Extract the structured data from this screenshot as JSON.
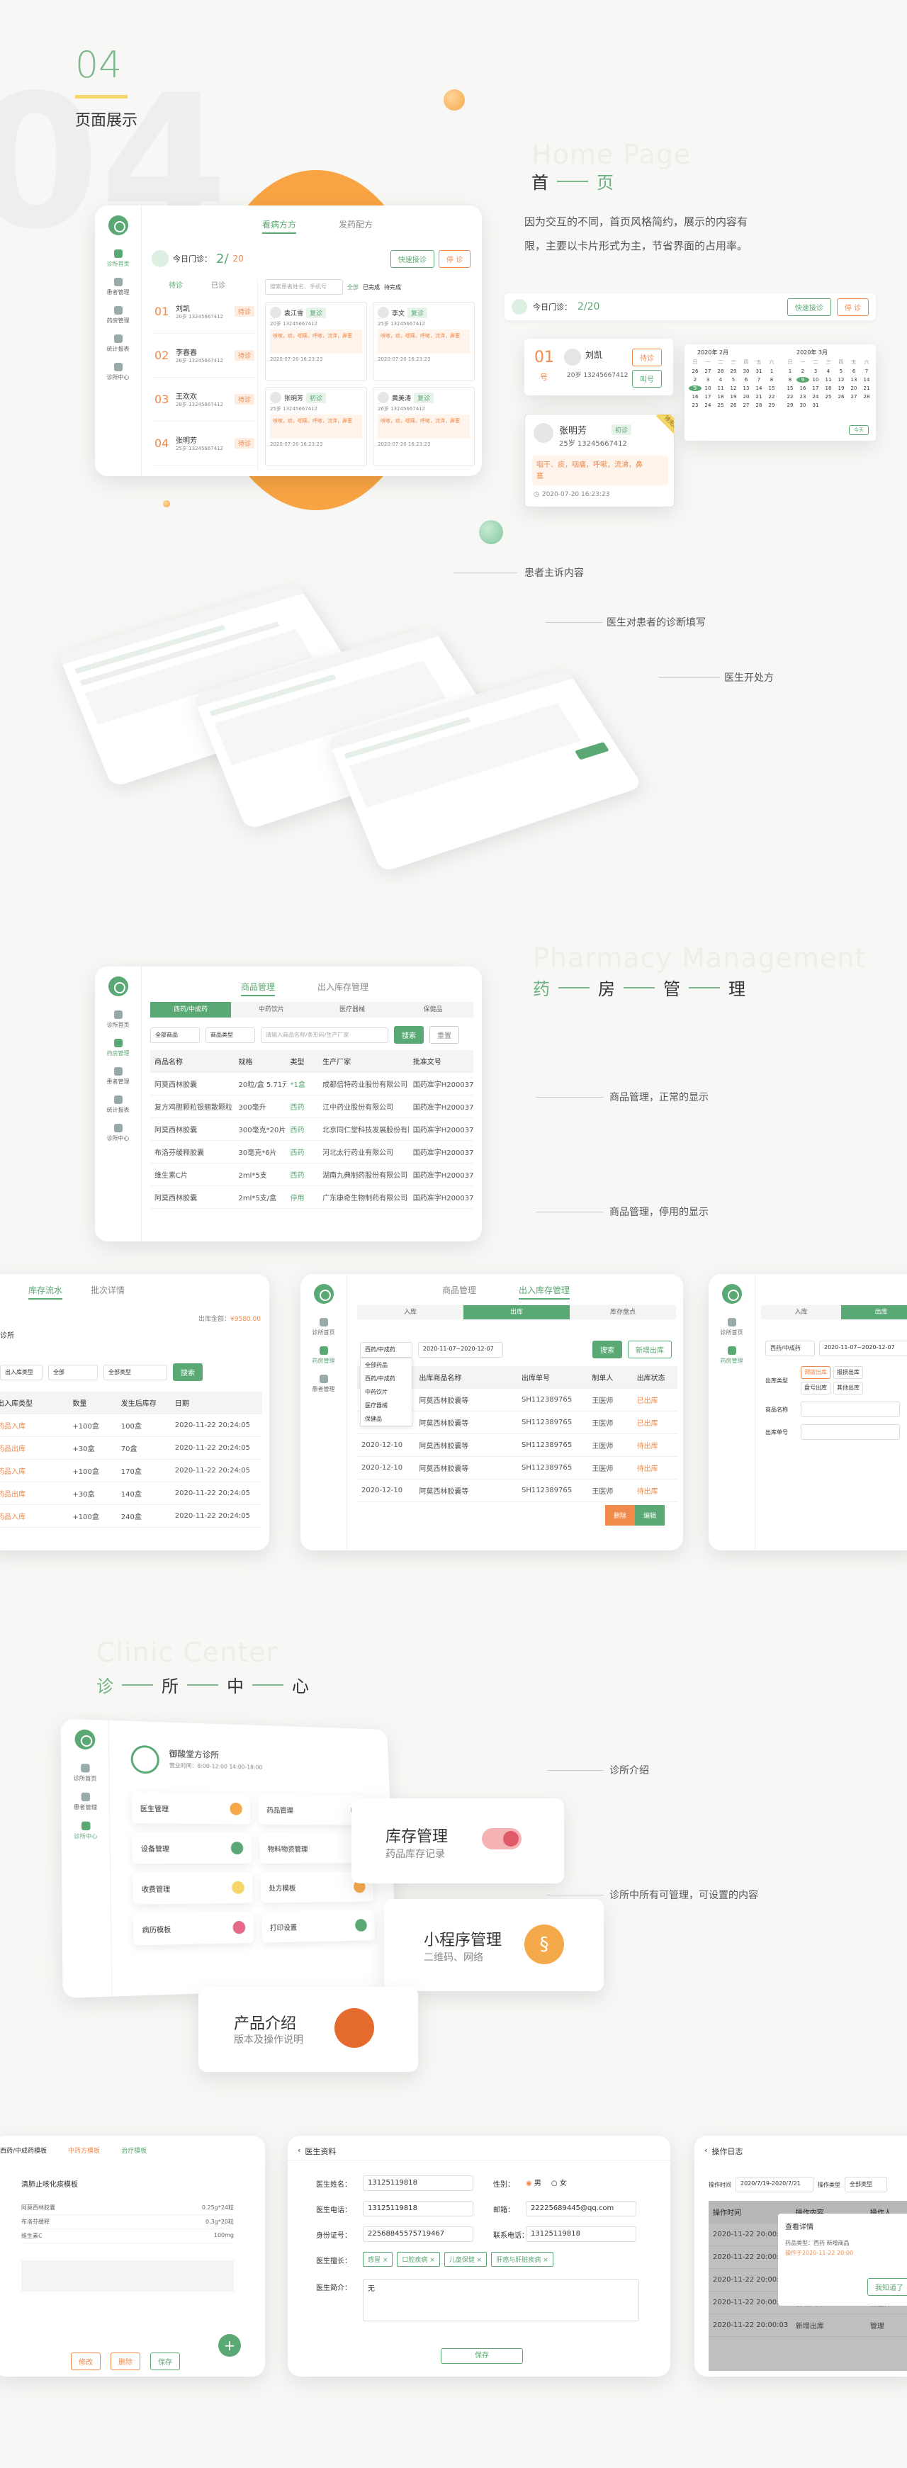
{
  "section": {
    "number": "04",
    "title": "页面展示",
    "ghost_number": "04"
  },
  "home": {
    "ghost_title": "Home Page",
    "title_a": "首",
    "title_b": "页",
    "desc_line1": "因为交互的不同，首页风格简约，展示的内容有",
    "desc_line2": "限，主要以卡片形式为主，节省界面的占用率。",
    "tabs": [
      "看病方方",
      "发药配方"
    ],
    "today_label": "今日门诊：",
    "today_count": "2/",
    "today_total": "20",
    "btn_fast": "快速接诊",
    "btn_stop": "停 诊",
    "list_tabs": [
      "待诊",
      "已诊"
    ],
    "queue": [
      {
        "num": "01",
        "name": "刘凯",
        "info": "20岁 13245667412",
        "state": "待诊"
      },
      {
        "num": "02",
        "name": "李春春",
        "info": "26岁 13245667412",
        "state": "待诊"
      },
      {
        "num": "03",
        "name": "王欢欢",
        "info": "28岁 13245667412",
        "state": "待诊"
      },
      {
        "num": "04",
        "name": "张明芳",
        "info": "25岁 13245667412",
        "state": "待诊"
      }
    ],
    "search_placeholder": "搜索患者姓名、手机号",
    "filter_all": "全部",
    "filter_done": "已完成",
    "filter_wait": "待完成",
    "patient_cards": [
      {
        "name": "袁江雪",
        "info": "20岁 13245667412",
        "tag": "复诊",
        "complaint": "咳嗽，痰，咽痛，呼嗽，流涕，鼻塞",
        "time": "2020-07-20 16:23:23"
      },
      {
        "name": "李文",
        "info": "25岁 13245667412",
        "tag": "复诊",
        "complaint": "咳嗽，痰，咽痛，呼嗽，流涕，鼻塞",
        "time": "2020-07-20 16:23:23"
      },
      {
        "name": "张明芳",
        "info": "25岁 13245667412",
        "tag": "初诊",
        "complaint": "咳嗽，痰，咽痛，呼嗽，流涕，鼻塞",
        "time": "2020-07-20 16:23:23"
      },
      {
        "name": "黄美涛",
        "info": "26岁 13245667412",
        "tag": "复诊",
        "complaint": "咳嗽，痰，咽痛，呼嗽，流涕，鼻塞",
        "time": "2020-07-20 16:23:23"
      }
    ],
    "detail_today_label": "今日门诊：",
    "detail_today": "2/20",
    "detail_queue": {
      "num": "01",
      "num_suffix": "号",
      "name": "刘凯",
      "info": "20岁 13245667412",
      "btn_wait": "待诊",
      "btn_call": "叫号"
    },
    "detail_card": {
      "name": "张明芳",
      "info": "25岁 13245667412",
      "tag": "初诊",
      "complaint_1": "咽干、痰，咽痛，呼嗽，流涕，鼻",
      "complaint_2": "塞",
      "time": "2020-07-20  16:23:23",
      "ribbon": "待完成"
    },
    "calendar": {
      "month1": "2020年 2月",
      "month2": "2020年 3月",
      "weekdays": [
        "日",
        "一",
        "二",
        "三",
        "四",
        "五",
        "六"
      ],
      "days1": [
        "26",
        "27",
        "28",
        "29",
        "30",
        "31",
        "1",
        "2",
        "3",
        "4",
        "5",
        "6",
        "7",
        "8",
        "9",
        "10",
        "11",
        "12",
        "13",
        "14",
        "15",
        "16",
        "17",
        "18",
        "19",
        "20",
        "21",
        "22",
        "23",
        "24",
        "25",
        "26",
        "27",
        "28",
        "29"
      ],
      "days2": [
        "1",
        "2",
        "3",
        "4",
        "5",
        "6",
        "7",
        "8",
        "9",
        "10",
        "11",
        "12",
        "13",
        "14",
        "15",
        "16",
        "17",
        "18",
        "19",
        "20",
        "21",
        "22",
        "23",
        "24",
        "25",
        "26",
        "27",
        "28",
        "29",
        "30",
        "31"
      ],
      "today_btn": "今天"
    },
    "callouts": [
      "患者主诉内容",
      "医生对患者的诊断填写",
      "医生开处方"
    ]
  },
  "pharmacy": {
    "ghost_title": "Pharmacy Management",
    "title_chars": [
      "药",
      "房",
      "管",
      "理"
    ],
    "tabs": [
      "商品管理",
      "出入库存管理"
    ],
    "sub_tabs": [
      "西药/中成药",
      "中药饮片",
      "医疗器械",
      "保健品"
    ],
    "filter_all": "全部商品",
    "filter_type": "商品类型",
    "search_placeholder": "请输入商品名称/条形码/生产厂家",
    "btn_search": "搜索",
    "btn_reset": "重置",
    "columns": [
      "商品名称",
      "规格",
      "类型",
      "生产厂家",
      "批准文号"
    ],
    "rows": [
      [
        "阿莫西林胶囊",
        "20粒/盒  5.71元",
        "*1盒",
        "成都倍特药业股份有限公司",
        "国药准字H20003795"
      ],
      [
        "复方鸡胆颗粒银翘散颗粒",
        "300毫升",
        "西药",
        "江中药业股份有限公司",
        "国药准字H20003795"
      ],
      [
        "阿莫西林胶囊",
        "300毫克*20片",
        "西药",
        "北京同仁堂科技发展股份有限公司",
        "国药准字H20003795"
      ],
      [
        "布洛芬缓释胶囊",
        "30毫克*6片",
        "西药",
        "河北太行药业有限公司",
        "国药准字H20003795"
      ],
      [
        "维生素C片",
        "2ml*5支",
        "西药",
        "湖南九典制药股份有限公司",
        "国药准字H20003795"
      ],
      [
        "阿莫西林胶囊",
        "2ml*5支/盒",
        "停用",
        "广东康奇生物制药有限公司",
        "国药准字H20003795"
      ]
    ],
    "callouts": [
      "商品管理，正常的显示",
      "商品管理，停用的显示"
    ]
  },
  "stock": {
    "left": {
      "tabs": [
        "库存流水",
        "批次详情"
      ],
      "clinic_label": "诊所",
      "filter_type": "出入库类型",
      "filter_all": "全部",
      "filter_all2": "全部类型",
      "btn_search": "搜索",
      "total_label": "出库金额：",
      "total_value": "¥9580.00",
      "columns": [
        "出入库类型",
        "数量",
        "发生后库存",
        "日期"
      ],
      "rows": [
        [
          "药品入库",
          "+100盒",
          "100盒",
          "2020-11-22 20:24:05"
        ],
        [
          "药品出库",
          "+30盒",
          "70盒",
          "2020-11-22 20:24:05"
        ],
        [
          "药品入库",
          "+100盒",
          "170盒",
          "2020-11-22 20:24:05"
        ],
        [
          "药品出库",
          "+30盒",
          "140盒",
          "2020-11-22 20:24:05"
        ],
        [
          "药品入库",
          "+100盒",
          "240盒",
          "2020-11-22 20:24:05"
        ]
      ]
    },
    "mid": {
      "tabs": [
        "商品管理",
        "出入库存管理"
      ],
      "sub_tabs": [
        "入库",
        "出库",
        "库存盘点"
      ],
      "select_label": "西药/中成药",
      "dropdown": [
        "全部药品",
        "西药/中成药",
        "中药饮片",
        "医疗器械",
        "保健品"
      ],
      "date_range": "2020-11-07~2020-12-07",
      "btn_search": "搜索",
      "btn_add": "新增出库",
      "columns": [
        "出库日期",
        "出库商品名称",
        "出库单号",
        "制单人",
        "出库状态"
      ],
      "rows": [
        [
          "2020-12-10",
          "阿莫西林胶囊等",
          "SH112389765",
          "王医师",
          "已出库"
        ],
        [
          "2020-12-10",
          "阿莫西林胶囊等",
          "SH112389765",
          "王医师",
          "已出库"
        ],
        [
          "2020-12-10",
          "阿莫西林胶囊等",
          "SH112389765",
          "王医师",
          "待出库"
        ],
        [
          "2020-12-10",
          "阿莫西林胶囊等",
          "SH112389765",
          "王医师",
          "待出库"
        ],
        [
          "2020-12-10",
          "阿莫西林胶囊等",
          "SH112389765",
          "王医师",
          "待出库"
        ]
      ],
      "btn_delete": "删除",
      "btn_edit": "编辑"
    },
    "right": {
      "sub_tabs": [
        "入库",
        "出库"
      ],
      "date_range": "2020-11-07~2020-12-07",
      "form_rows": [
        "出库类型",
        "商品名称",
        "出库单号"
      ],
      "options": [
        "调拨出库",
        "报损出库",
        "盘亏出库",
        "其他出库"
      ]
    }
  },
  "clinic": {
    "ghost_title": "Clinic Center",
    "title_chars": [
      "诊",
      "所",
      "中",
      "心"
    ],
    "clinic_name": "御酸堂方诊所",
    "clinic_info": "营业时间：8:00-12:00  14:00-18:00",
    "tiles": [
      {
        "title": "库存管理",
        "sub": "药品库存记录"
      },
      {
        "title": "小程序管理",
        "sub": "二维码、网络"
      },
      {
        "title": "产品介绍",
        "sub": "版本及操作说明"
      }
    ],
    "small_tiles": [
      "医生管理",
      "药品管理",
      "设备管理",
      "物料物资管理",
      "收费管理",
      "处方模板",
      "病历模板",
      "打印设置"
    ],
    "callouts": [
      "诊所介绍",
      "诊所中所有可管理，可设置的内容"
    ]
  },
  "bottom": {
    "recipe": {
      "tabs": [
        "西药/中成药模板",
        "中药方模板",
        "治疗模板"
      ],
      "title": "清肺止咳化痰模板",
      "rows": [
        [
          "阿莫西林胶囊",
          "0.25g*24粒"
        ],
        [
          "布洛芬缓释",
          "0.3g*20粒"
        ],
        [
          "维生素C",
          "100mg"
        ]
      ],
      "btn_edit": "修改",
      "btn_del": "删除",
      "btn_save": "保存"
    },
    "profile": {
      "back": "医生资料",
      "labels": [
        "医生姓名：",
        "医生电话：",
        "身份证号：",
        "医生擅长：",
        "医生简介：",
        "性别：",
        "邮箱：",
        "联系电话："
      ],
      "values": [
        "13125119818",
        "13125119818",
        "22568845575719467",
        "",
        "无",
        "男",
        "22225689445@qq.com",
        "13125119818"
      ],
      "gender_opts": [
        "男",
        "女"
      ],
      "tags": [
        "感冒 ×",
        "口腔疾病 ×",
        "儿童保健 ×",
        "肝癌与肝脏疾病 ×"
      ],
      "btn_save": "保存"
    },
    "log": {
      "back": "操作日志",
      "filter_label": "操作时间",
      "date_range": "2020/7/19-2020/7/21",
      "op_label": "操作类型",
      "op_all": "全部类型",
      "columns": [
        "操作时间",
        "操作内容",
        "操作人"
      ],
      "rows": [
        [
          "2020-11-22 20:00:03",
          "新增商品",
          "王医师"
        ],
        [
          "2020-11-22 20:00:03",
          "删除商品",
          "王医师"
        ],
        [
          "2020-11-22 20:00:03",
          "修改价格",
          "王医师"
        ],
        [
          "2020-11-22 20:00:03",
          "新增入库",
          "王医师"
        ],
        [
          "2020-11-22 20:00:03",
          "新增出库",
          "管理"
        ]
      ],
      "modal_title": "查看详情",
      "modal_text_1": "药品类型：西药 新增商品",
      "modal_text_2": "操作于2020-11-22 20:00",
      "modal_btn": "我知道了"
    }
  },
  "colors": {
    "green": "#5aa873",
    "orange": "#f08a4b",
    "yellow": "#f6d66a"
  }
}
